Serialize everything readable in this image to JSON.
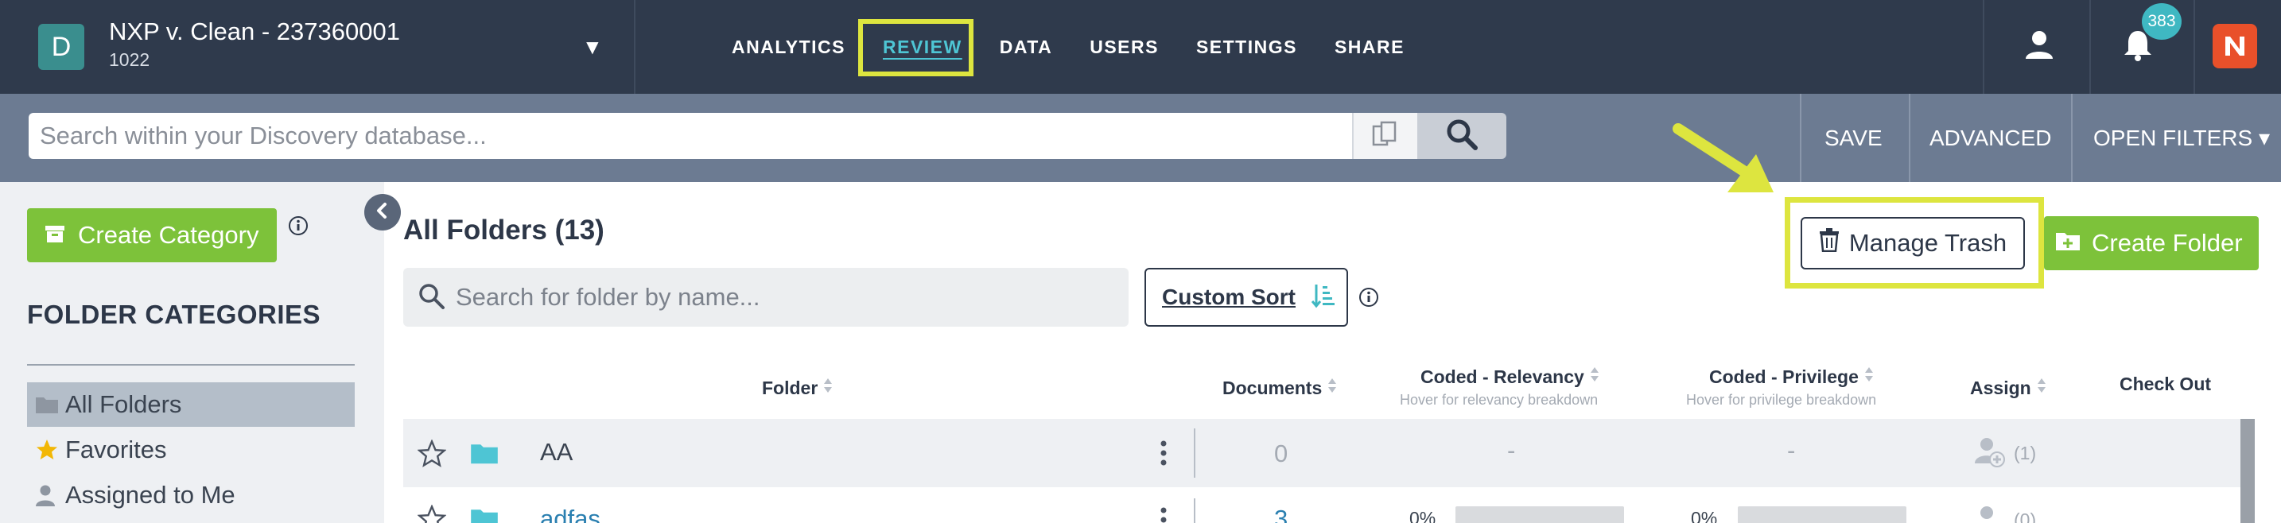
{
  "header": {
    "avatar_letter": "D",
    "db_name": "NXP v. Clean - 237360001",
    "db_sub": "1022",
    "nav": [
      "ANALYTICS",
      "REVIEW",
      "DATA",
      "USERS",
      "SETTINGS",
      "SHARE"
    ],
    "active_nav": "REVIEW",
    "notification_count": "383"
  },
  "search_row": {
    "placeholder": "Search within your Discovery database...",
    "save": "SAVE",
    "advanced": "ADVANCED",
    "open_filters": "OPEN FILTERS ▾"
  },
  "sidebar": {
    "create_category": "Create Category",
    "title": "FOLDER CATEGORIES",
    "items": [
      {
        "label": "All Folders",
        "icon": "folder-icon",
        "selected": true
      },
      {
        "label": "Favorites",
        "icon": "star-icon",
        "selected": false
      },
      {
        "label": "Assigned to Me",
        "icon": "person-icon",
        "selected": false
      }
    ]
  },
  "main": {
    "title": "All Folders (13)",
    "folder_search_placeholder": "Search for folder by name...",
    "custom_sort": "Custom Sort",
    "manage_trash": "Manage Trash",
    "create_folder": "Create Folder",
    "columns": {
      "folder": "Folder",
      "documents": "Documents",
      "coded_relevancy": "Coded - Relevancy",
      "coded_relevancy_sub": "Hover for relevancy breakdown",
      "coded_privilege": "Coded - Privilege",
      "coded_privilege_sub": "Hover for privilege breakdown",
      "assign": "Assign",
      "check_out": "Check Out"
    },
    "rows": [
      {
        "name": "AA",
        "documents": "0",
        "relevancy": "-",
        "privilege": "-",
        "assign_count": "(1)"
      },
      {
        "name": "adfas",
        "documents": "3",
        "relevancy": "0%",
        "privilege": "0%",
        "assign_count": "(0)"
      }
    ]
  },
  "colors": {
    "topbar": "#2f3a4c",
    "search_row": "#6c7b92",
    "accent_green": "#7dc23a",
    "highlight_yellow": "#dde53f",
    "teal": "#4ec5d4"
  }
}
